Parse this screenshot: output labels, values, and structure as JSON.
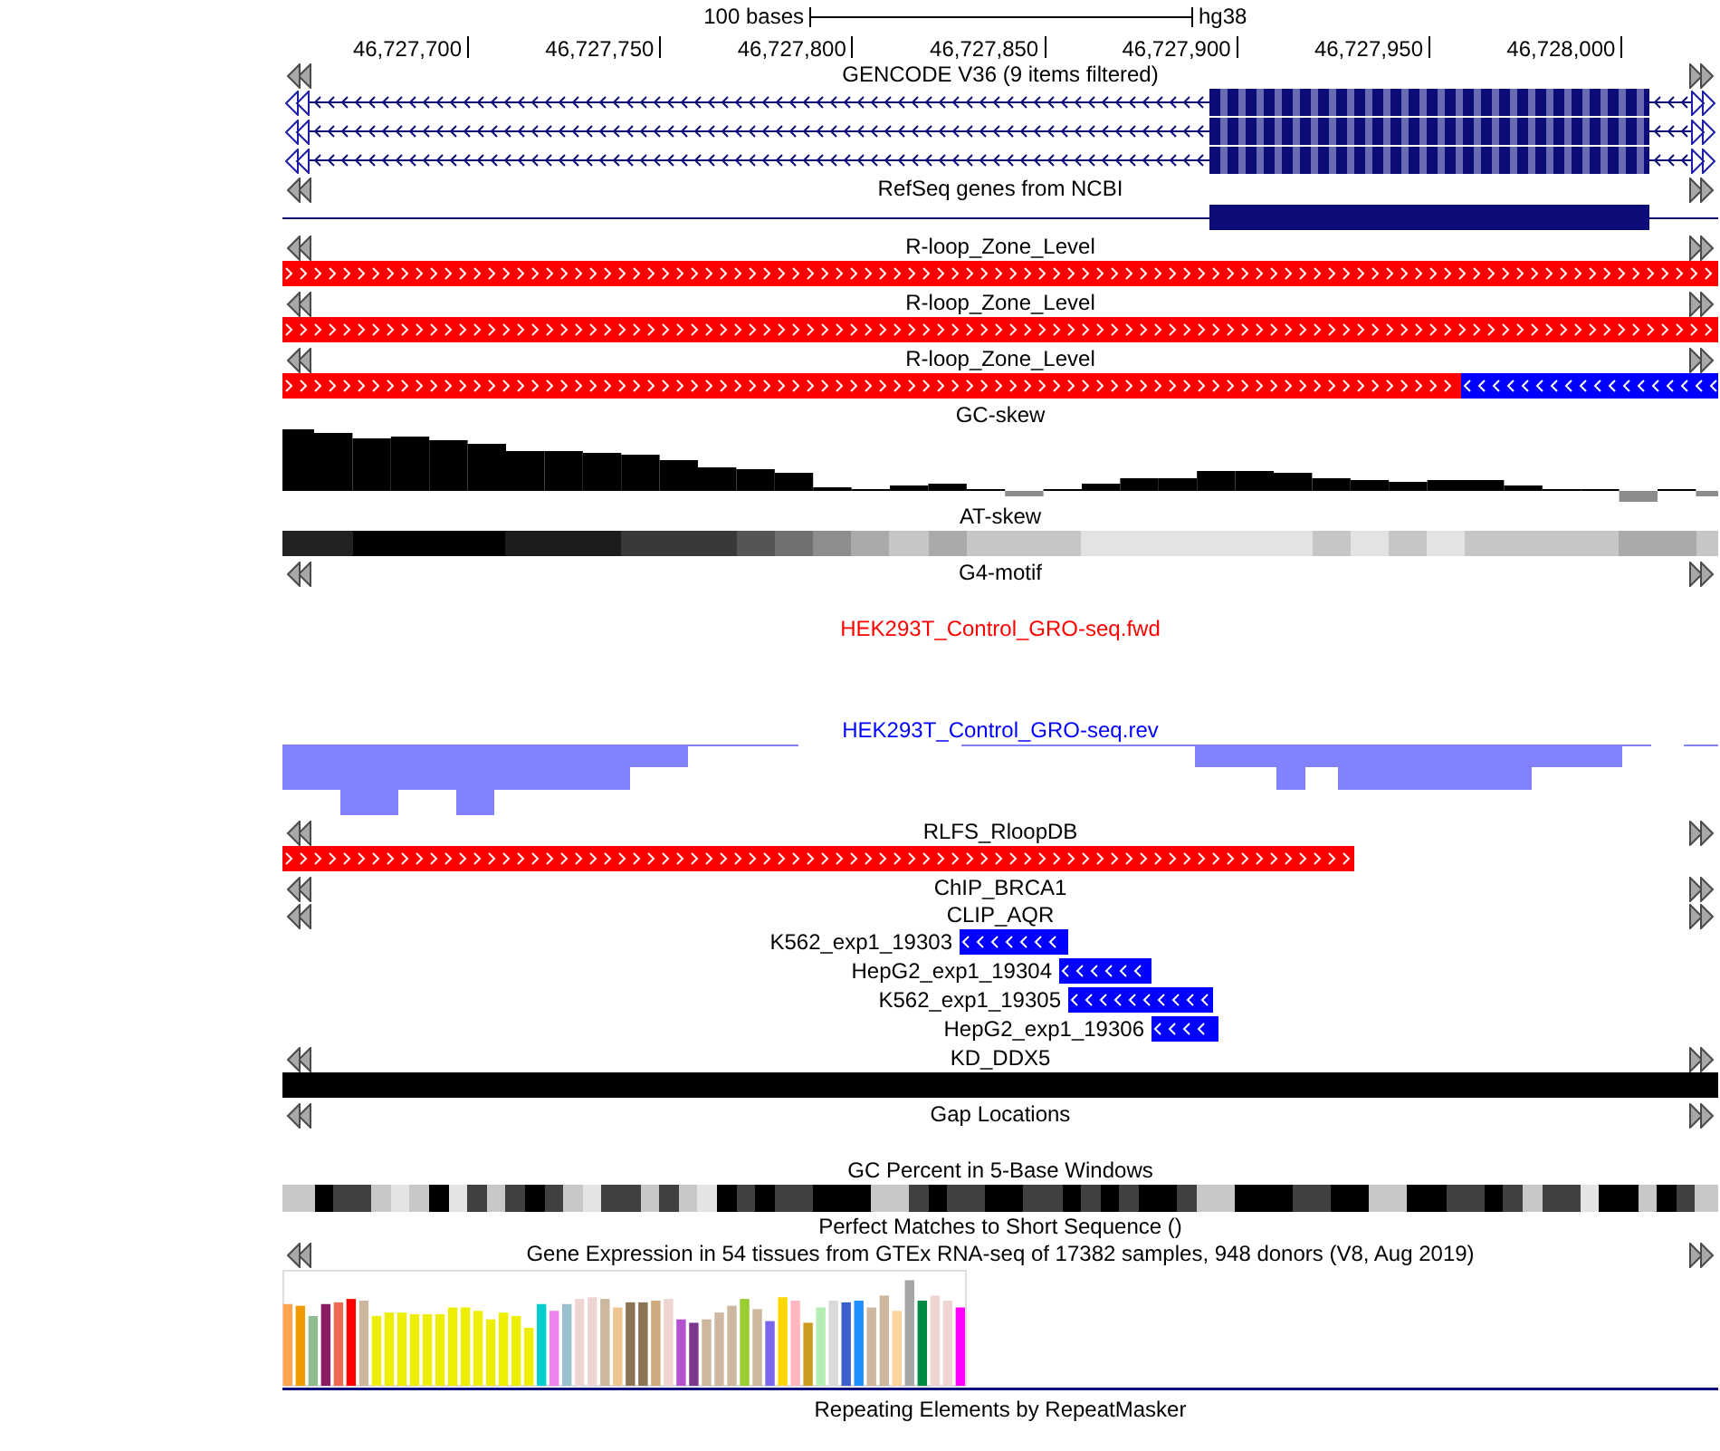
{
  "ruler": {
    "scale_label": "100 bases",
    "assembly": "hg38",
    "ticks": [
      "46,727,700",
      "46,727,750",
      "46,727,800",
      "46,727,850",
      "46,727,900",
      "46,727,950",
      "46,728,000"
    ]
  },
  "tracks": [
    {
      "kind": "gene_models",
      "title": "GENCODE V36 (9 items filtered)",
      "color": "#000000",
      "nav_arrows": true,
      "items": [
        {
          "kind": "reverse"
        },
        {
          "kind": "reverse"
        },
        {
          "kind": "reverse"
        }
      ]
    },
    {
      "kind": "gene_line",
      "title": "RefSeq genes from NCBI",
      "color": "#000000",
      "nav_arrows": true
    },
    {
      "kind": "features",
      "title": "R-loop_Zone_Level",
      "color": "#000000",
      "nav_arrows": true,
      "items": [
        {
          "kind": "forward"
        }
      ]
    },
    {
      "kind": "features",
      "title": "R-loop_Zone_Level",
      "color": "#000000",
      "nav_arrows": true,
      "items": [
        {
          "kind": "forward"
        }
      ]
    },
    {
      "kind": "features",
      "title": "R-loop_Zone_Level",
      "color": "#000000",
      "nav_arrows": true,
      "items": [
        {
          "kind": "forward"
        },
        {
          "kind": "reverse"
        }
      ]
    },
    {
      "kind": "skew_graph",
      "title": "GC-skew",
      "color": "#000000",
      "nav_arrows": false
    },
    {
      "kind": "heatmap",
      "title": "AT-skew",
      "color": "#000000",
      "nav_arrows": false
    },
    {
      "kind": "empty_lane",
      "title": "G4-motif",
      "color": "#000000",
      "nav_arrows": true
    },
    {
      "kind": "signal_graph",
      "title": "HEK293T_Control_GRO-seq.fwd",
      "color": "#ff0000",
      "nav_arrows": false
    },
    {
      "kind": "signal_graph",
      "title": "HEK293T_Control_GRO-seq.rev",
      "color": "#0000ff",
      "nav_arrows": false
    },
    {
      "kind": "features",
      "title": "RLFS_RloopDB",
      "color": "#000000",
      "nav_arrows": true,
      "items": [
        {
          "kind": "forward"
        }
      ]
    },
    {
      "kind": "title_only",
      "title": "ChIP_BRCA1",
      "color": "#000000",
      "nav_arrows": true
    },
    {
      "kind": "labeled_features",
      "title": "CLIP_AQR",
      "color": "#000000",
      "nav_arrows": true,
      "items": [
        {
          "label": "K562_exp1_19303",
          "kind": "reverse"
        },
        {
          "label": "HepG2_exp1_19304",
          "kind": "reverse"
        },
        {
          "label": "K562_exp1_19305",
          "kind": "reverse"
        },
        {
          "label": "HepG2_exp1_19306",
          "kind": "reverse"
        }
      ]
    },
    {
      "kind": "features",
      "title": "KD_DDX5",
      "color": "#000000",
      "nav_arrows": true,
      "items": [
        {
          "kind": "unstranded"
        }
      ]
    },
    {
      "kind": "empty_lane",
      "title": "Gap Locations",
      "color": "#000000",
      "nav_arrows": true
    },
    {
      "kind": "heatmap",
      "title": "GC Percent in 5-Base Windows",
      "color": "#000000",
      "nav_arrows": false
    },
    {
      "kind": "title_only",
      "title": "Perfect Matches to Short Sequence ()",
      "color": "#000000",
      "nav_arrows": false
    },
    {
      "kind": "expression_graph",
      "title": "Gene Expression in 54 tissues from GTEx RNA-seq of 17382 samples, 948 donors (V8, Aug 2019)",
      "color": "#000000",
      "nav_arrows": true
    },
    {
      "kind": "title_only",
      "title": "Repeating Elements by RepeatMasker",
      "color": "#000000",
      "nav_arrows": false
    }
  ]
}
